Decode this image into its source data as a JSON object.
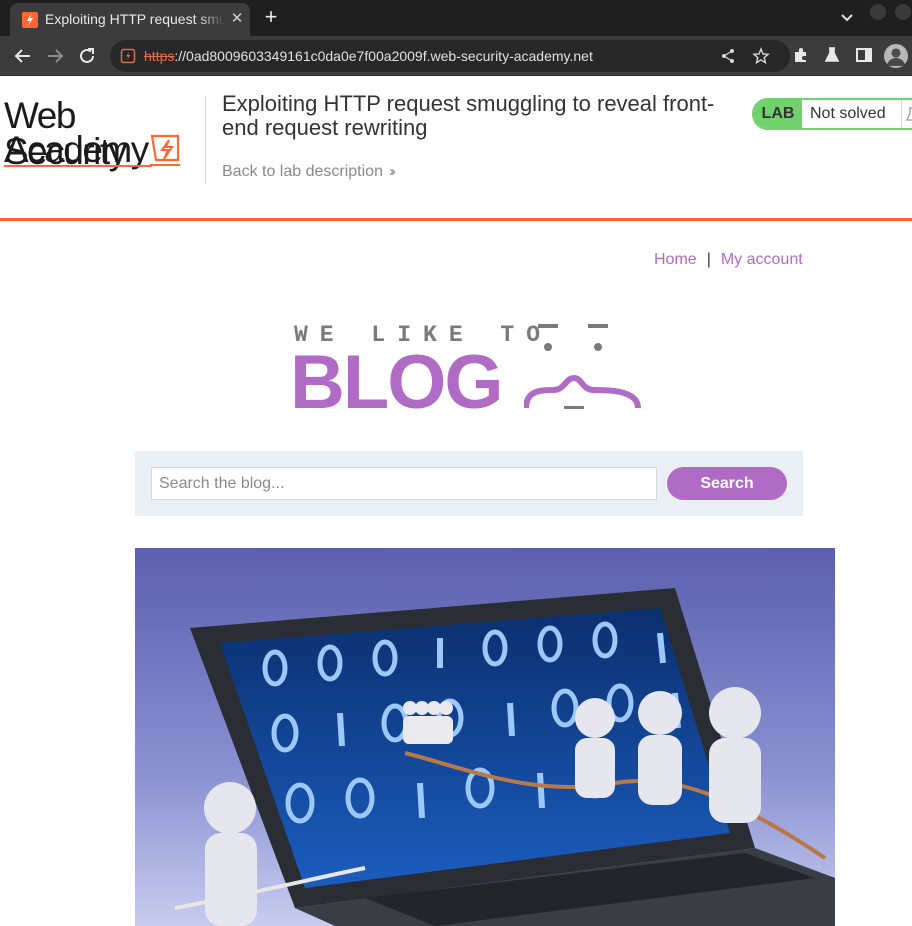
{
  "browser": {
    "tab_title": "Exploiting HTTP request smuggling to reveal front-end request rewriting",
    "url_scheme": "https",
    "url_rest": "://0ad8009603349161c0da0e7f00a2009f.web-security-academy.net"
  },
  "lab": {
    "logo_line1": "Web Security",
    "logo_line2": "Academy",
    "title": "Exploiting HTTP request smuggling to reveal front-end request rewriting",
    "back_link": "Back to lab description",
    "badge": "LAB",
    "status": "Not solved"
  },
  "blog": {
    "nav": {
      "home": "Home",
      "separator": "|",
      "account": "My account"
    },
    "banner_sub": "WE LIKE TO",
    "banner_main": "BLOG",
    "search": {
      "placeholder": "Search the blog...",
      "button": "Search"
    }
  },
  "colors": {
    "accent": "#ff6633",
    "blog_purple": "#b06cc5",
    "lab_green": "#70d16d"
  },
  "icons": [
    "back-icon",
    "forward-icon",
    "reload-icon",
    "lock-icon",
    "share-icon",
    "star-icon",
    "extensions-icon",
    "labs-icon",
    "side-panel-icon",
    "profile-icon"
  ]
}
